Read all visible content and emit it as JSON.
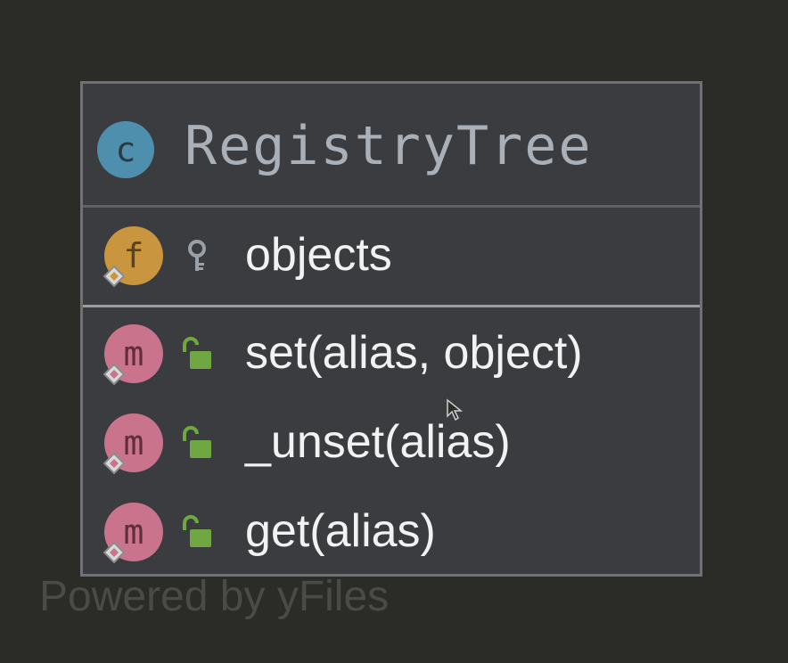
{
  "class": {
    "badge_letter": "c",
    "name": "RegistryTree",
    "badge_color": "#4e8fad"
  },
  "fields": [
    {
      "badge_letter": "f",
      "access": "private",
      "access_icon": "key-icon",
      "label": "objects"
    }
  ],
  "methods": [
    {
      "badge_letter": "m",
      "access": "public",
      "access_icon": "unlocked-padlock-icon",
      "label": "set(alias, object)"
    },
    {
      "badge_letter": "m",
      "access": "public",
      "access_icon": "unlocked-padlock-icon",
      "label": "_unset(alias)"
    },
    {
      "badge_letter": "m",
      "access": "public",
      "access_icon": "unlocked-padlock-icon",
      "label": "get(alias)"
    }
  ],
  "colors": {
    "field_badge": "#c9953e",
    "method_badge": "#c9738c",
    "public_access": "#6fa843",
    "background": "#2b2b27",
    "node_fill": "#3b3c3f"
  },
  "watermark": "Powered by yFiles"
}
